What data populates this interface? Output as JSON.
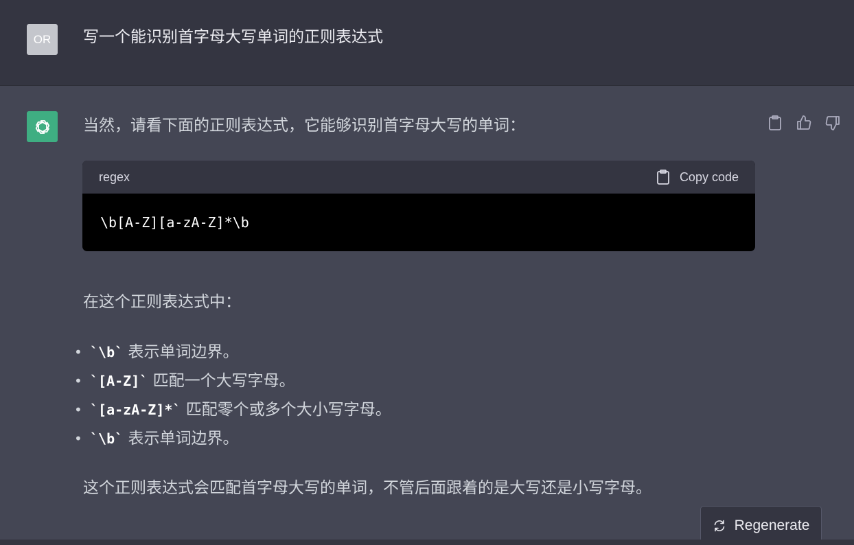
{
  "user_message": {
    "avatar_initials": "OR",
    "text": "写一个能识别首字母大写单词的正则表达式"
  },
  "assistant_message": {
    "intro": "当然，请看下面的正则表达式，它能够识别首字母大写的单词：",
    "code_block": {
      "language": "regex",
      "copy_label": "Copy code",
      "code": "\\b[A-Z][a-zA-Z]*\\b"
    },
    "explanation_intro": "在这个正则表达式中：",
    "bullets": [
      {
        "code": "`\\b`",
        "text": " 表示单词边界。"
      },
      {
        "code": "`[A-Z]`",
        "text": " 匹配一个大写字母。"
      },
      {
        "code": "`[a-zA-Z]*`",
        "text": " 匹配零个或多个大小写字母。"
      },
      {
        "code": "`\\b`",
        "text": " 表示单词边界。"
      }
    ],
    "summary": "这个正则表达式会匹配首字母大写的单词，不管后面跟着的是大写还是小写字母。"
  },
  "actions": {
    "icons": [
      "clipboard-icon",
      "thumbs-up-icon",
      "thumbs-down-icon"
    ]
  },
  "regenerate": {
    "label": "Regenerate",
    "icon": "refresh-icon"
  },
  "colors": {
    "user_bg": "#343541",
    "assistant_bg": "#444654",
    "avatar_bot": "#3fae82",
    "avatar_user": "#c4c6cc",
    "code_bg": "#000000",
    "code_header_bg": "#343541"
  }
}
